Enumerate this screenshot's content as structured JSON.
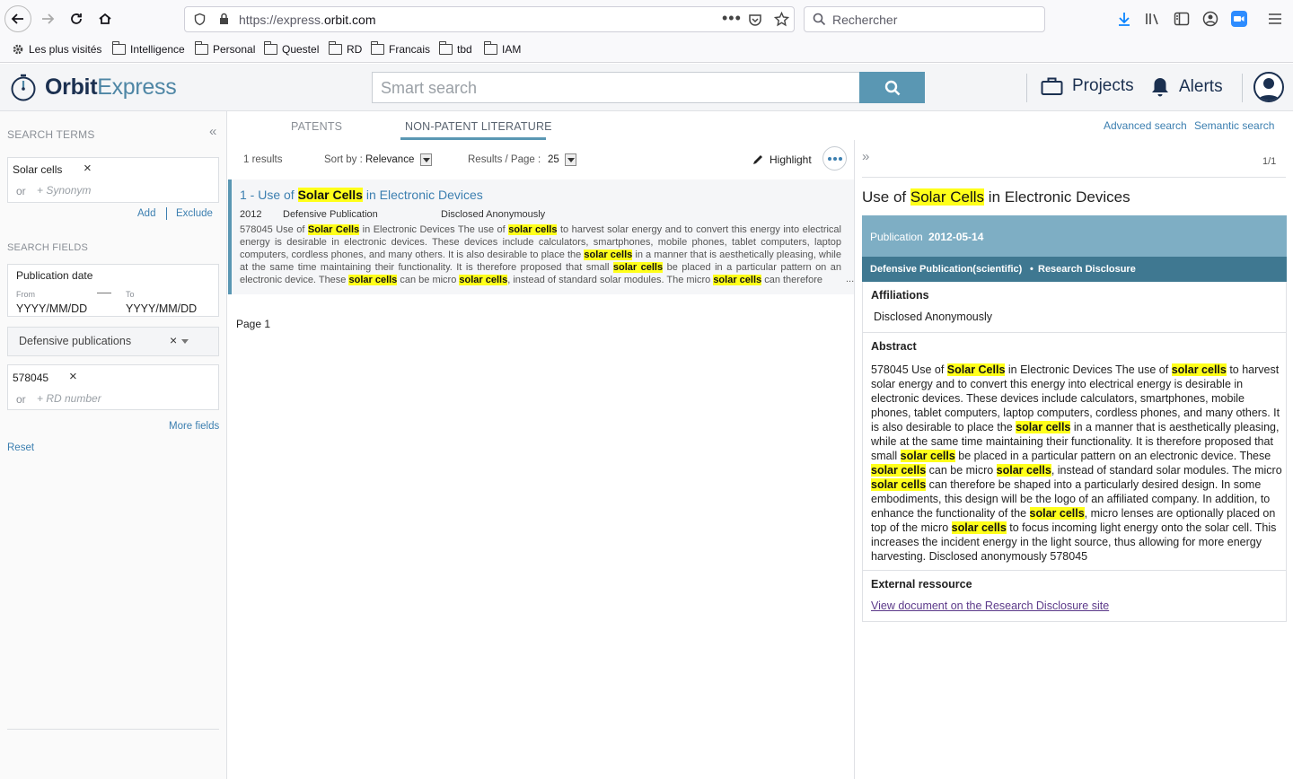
{
  "browser": {
    "url_prefix": "https://express.",
    "url_host": "orbit.com",
    "search_placeholder": "Rechercher",
    "bookmarks": [
      "Les plus visités",
      "Intelligence",
      "Personal",
      "Questel",
      "RD",
      "Francais",
      "tbd",
      "IAM"
    ]
  },
  "app": {
    "logo_bold": "Orbit",
    "logo_light": "Express",
    "smart_search_placeholder": "Smart search",
    "projects_label": "Projects",
    "alerts_label": "Alerts"
  },
  "sidebar": {
    "search_terms_title": "SEARCH TERMS",
    "term": "Solar cells",
    "or_label": "or",
    "synonym_placeholder": "+ Synonym",
    "add_label": "Add",
    "exclude_label": "Exclude",
    "search_fields_title": "SEARCH FIELDS",
    "pub_date_label": "Publication date",
    "from_label": "From",
    "to_label": "To",
    "from_placeholder": "YYYY/MM/DD",
    "to_placeholder": "YYYY/MM/DD",
    "select_value": "Defensive publications",
    "rd_value": "578045",
    "rd_placeholder": "+ RD number",
    "more_fields_label": "More fields",
    "reset_label": "Reset"
  },
  "tabs": {
    "patents": "PATENTS",
    "npl": "NON-PATENT LITERATURE",
    "advanced": "Advanced search",
    "semantic": "Semantic search"
  },
  "results": {
    "count": "1 results",
    "sort_label": "Sort by :",
    "sort_value": "Relevance",
    "per_page_label": "Results / Page :",
    "per_page_value": "25",
    "highlight_label": "Highlight",
    "page_label": "Page 1",
    "item": {
      "title_prefix": "1 - Use of ",
      "title_hl": "Solar Cells",
      "title_suffix": " in Electronic Devices",
      "year": "2012",
      "type": "Defensive Publication",
      "author": "Disclosed Anonymously",
      "snippet_parts": [
        {
          "t": "578045 Use of "
        },
        {
          "h": "Solar Cells"
        },
        {
          "t": " in Electronic Devices The use of "
        },
        {
          "h": "solar cells"
        },
        {
          "t": " to harvest solar energy and to convert this energy into electrical energy is desirable in electronic devices. These devices include calculators, smartphones, mobile phones, tablet computers, laptop computers, cordless phones, and many others. It is also desirable to place the "
        },
        {
          "h": "solar cells"
        },
        {
          "t": " in a manner that is aesthetically pleasing, while at the same time maintaining their functionality. It is therefore proposed that small "
        },
        {
          "h": "solar cells"
        },
        {
          "t": " be placed in a particular pattern on an electronic device. These "
        },
        {
          "h": "solar cells"
        },
        {
          "t": " can be micro "
        },
        {
          "h": "solar cells"
        },
        {
          "t": ", instead of standard solar modules. The micro "
        },
        {
          "h": "solar cells"
        },
        {
          "t": " can therefore"
        }
      ],
      "ellipsis": "..."
    }
  },
  "detail": {
    "pager": "1/1",
    "title_prefix": "Use of ",
    "title_hl": "Solar Cells",
    "title_suffix": " in Electronic Devices",
    "pub_label": "Publication",
    "pub_date": "2012-05-14",
    "pub_type": "Defensive Publication(scientific)",
    "pub_source": "Research Disclosure",
    "affiliations_title": "Affiliations",
    "affiliations_value": "Disclosed Anonymously",
    "abstract_title": "Abstract",
    "abstract_parts": [
      {
        "t": "578045 Use of "
      },
      {
        "h": "Solar Cells"
      },
      {
        "t": " in Electronic Devices The use of "
      },
      {
        "h": "solar cells"
      },
      {
        "t": " to harvest solar energy and to convert this energy into electrical energy is desirable in electronic devices. These devices include calculators, smartphones, mobile phones, tablet computers, laptop computers, cordless phones, and many others. It is also desirable to place the "
      },
      {
        "h": "solar cells"
      },
      {
        "t": " in a manner that is aesthetically pleasing, while at the same time maintaining their functionality. It is therefore proposed that small "
      },
      {
        "h": "solar cells"
      },
      {
        "t": " be placed in a particular pattern on an electronic device. These "
      },
      {
        "h": "solar cells"
      },
      {
        "t": " can be micro "
      },
      {
        "h": "solar cells"
      },
      {
        "t": ", instead of standard solar modules. The micro "
      },
      {
        "h": "solar cells"
      },
      {
        "t": " can therefore be shaped into a particularly desired design. In some embodiments, this design will be the logo of an affiliated company. In addition, to enhance the functionality of the "
      },
      {
        "h": "solar cells"
      },
      {
        "t": ", micro lenses are optionally placed on top of the micro "
      },
      {
        "h": "solar cells"
      },
      {
        "t": " to focus incoming light energy onto the solar cell. This increases the incident energy in the light source, thus allowing for more energy harvesting. Disclosed anonymously 578045"
      }
    ],
    "external_title": "External ressource",
    "external_link": "View document on the Research Disclosure site"
  },
  "colors": {
    "accent": "#5a97b3",
    "brand_dark": "#1b3050",
    "link": "#3c7fb0",
    "highlight": "#ffff1a"
  }
}
